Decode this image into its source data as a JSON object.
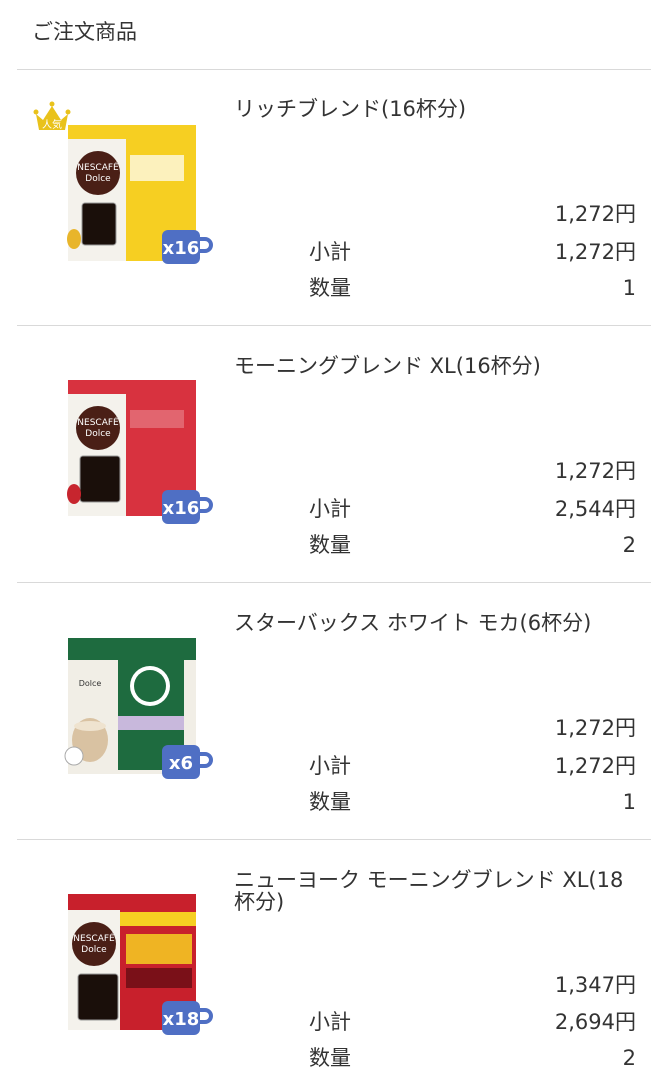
{
  "section": {
    "title": "ご注文商品"
  },
  "badge": {
    "popular_label": "人気"
  },
  "labels": {
    "subtotal": "小計",
    "quantity": "数量"
  },
  "colors": {
    "divider": "#d9d9d9",
    "cup_badge": "#4f6fc4",
    "crown": "#e9c21b"
  },
  "items": [
    {
      "name": "リッチブレンド(16杯分)",
      "unit_price": "1,272円",
      "subtotal": "1,272円",
      "quantity": "1",
      "cups": "x16",
      "box_accent": "#f6cf22",
      "popular": true
    },
    {
      "name": "モーニングブレンド XL(16杯分)",
      "unit_price": "1,272円",
      "subtotal": "2,544円",
      "quantity": "2",
      "cups": "x16",
      "box_accent": "#d8323f",
      "popular": false
    },
    {
      "name": "スターバックス ホワイト モカ(6杯分)",
      "unit_price": "1,272円",
      "subtotal": "1,272円",
      "quantity": "1",
      "cups": "x6",
      "box_accent": "#1e6b3f",
      "popular": false
    },
    {
      "name": "ニューヨーク モーニングブレンド XL(18杯分)",
      "unit_price": "1,347円",
      "subtotal": "2,694円",
      "quantity": "2",
      "cups": "x18",
      "box_accent": "#c8202c",
      "popular": false
    }
  ]
}
